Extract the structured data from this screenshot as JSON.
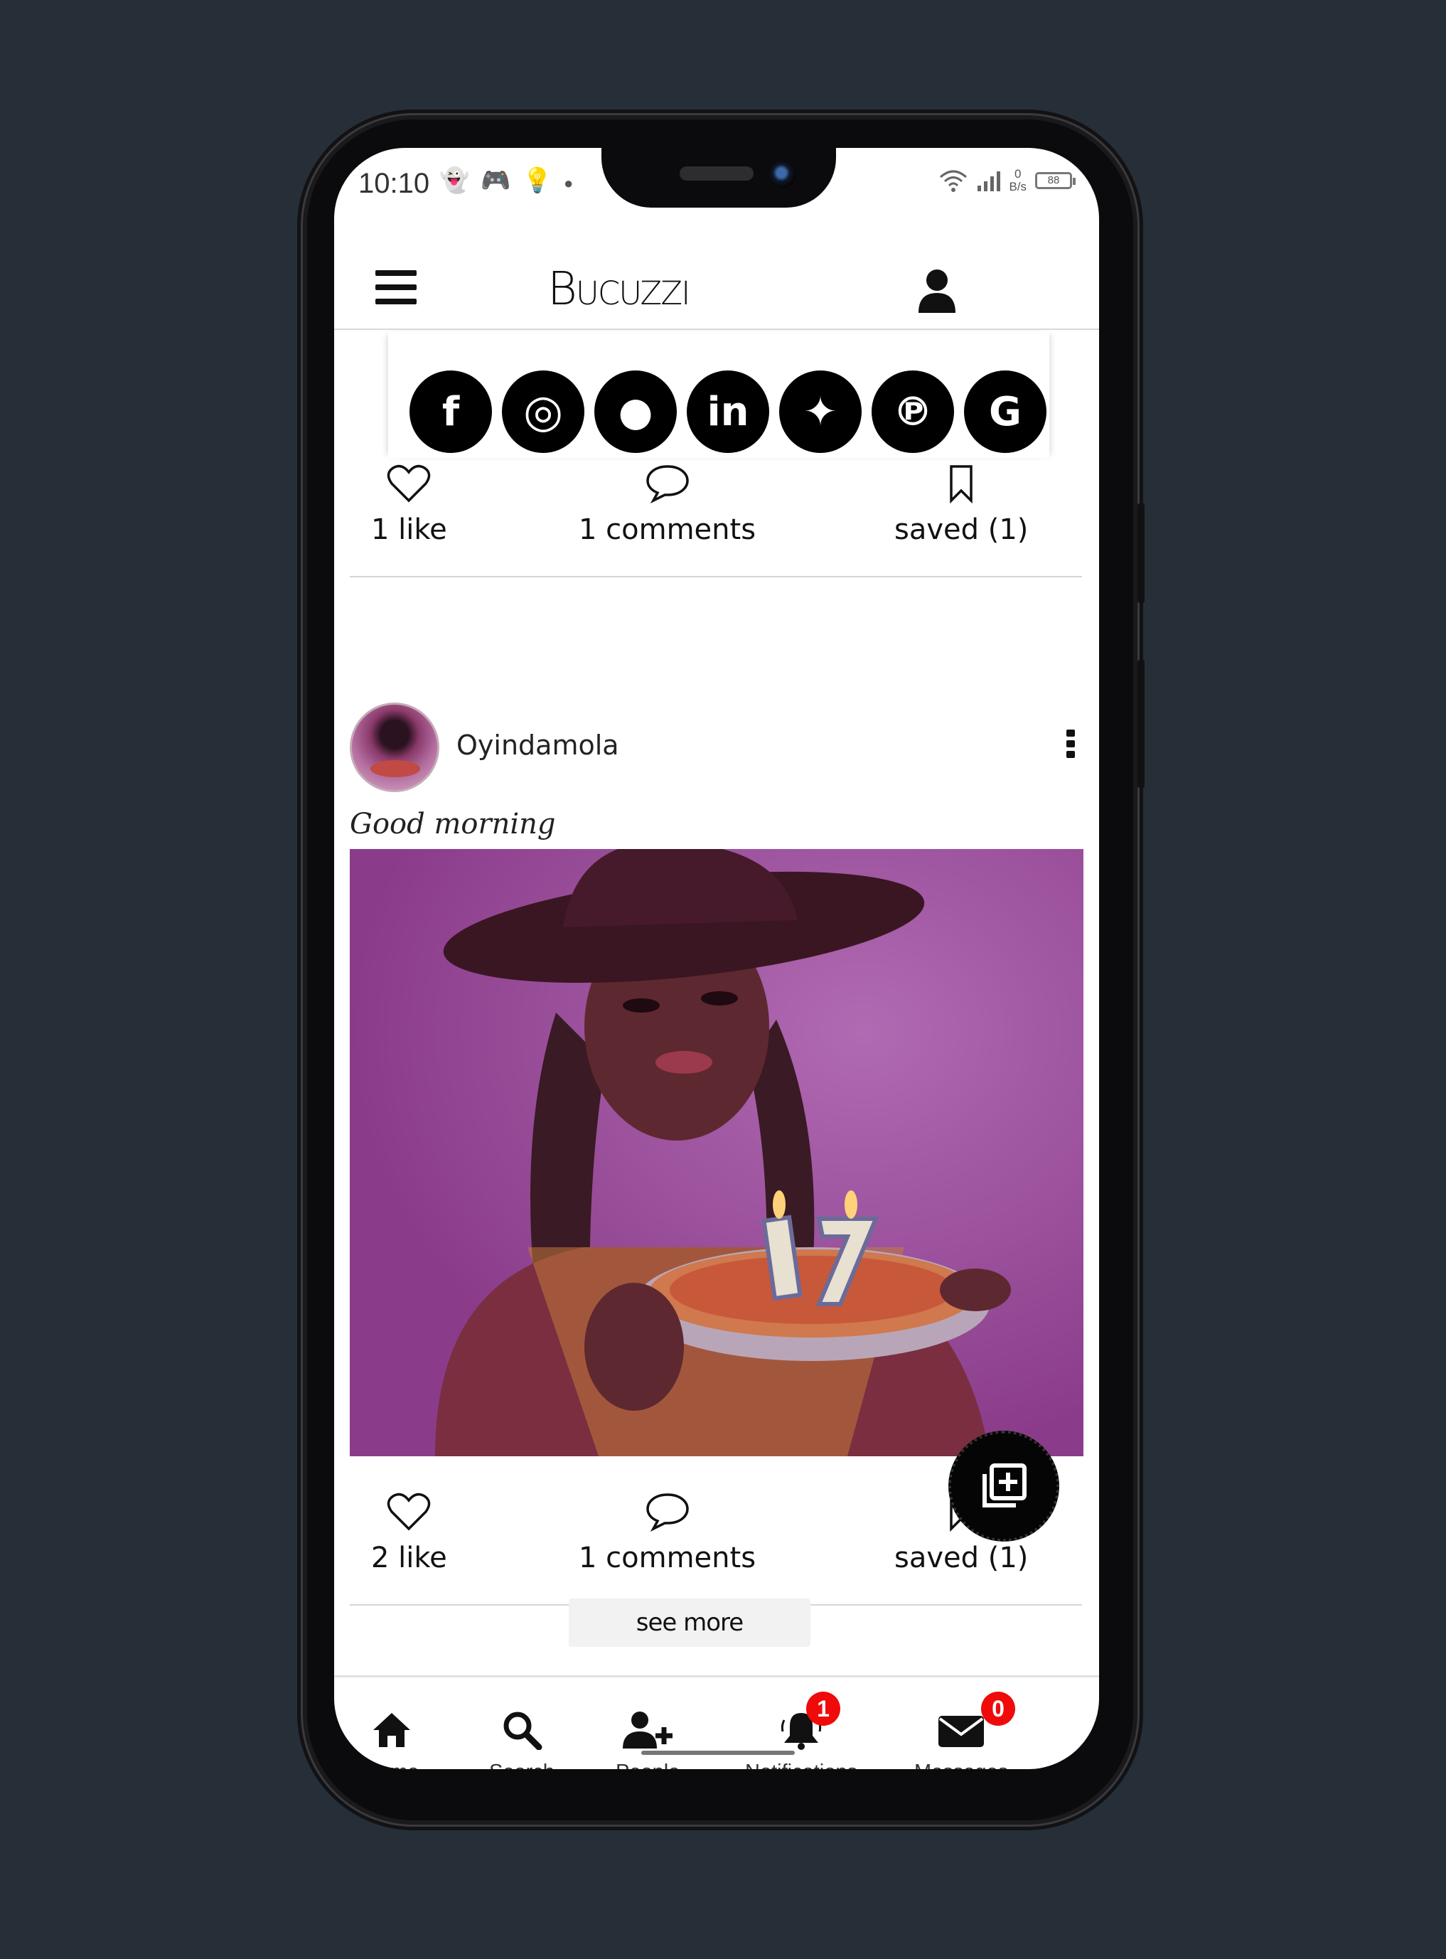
{
  "status_bar": {
    "time": "10:10",
    "left_icons": [
      "ghost-icon",
      "gamepad-icon",
      "bulb-icon",
      "dot-icon"
    ],
    "right_icons": [
      "wifi-icon",
      "signal-icon"
    ],
    "net_rate_value": "0",
    "net_rate_unit": "B/s",
    "battery": "88"
  },
  "app_bar": {
    "brand": "Bucuzzi",
    "menu_icon": "hamburger-icon",
    "profile_icon": "user-icon"
  },
  "social_links": [
    {
      "icon": "facebook-icon",
      "glyph": "f"
    },
    {
      "icon": "instagram-icon",
      "glyph": "◎"
    },
    {
      "icon": "github-icon",
      "glyph": "●"
    },
    {
      "icon": "linkedin-icon",
      "glyph": "in"
    },
    {
      "icon": "twitter-icon",
      "glyph": "✦"
    },
    {
      "icon": "pinterest-icon",
      "glyph": "℗"
    },
    {
      "icon": "google-icon",
      "glyph": "G"
    }
  ],
  "first_post_actions": {
    "likes": "1 like",
    "comments": "1 comments",
    "saved": "saved (1)"
  },
  "post": {
    "author": "Oyindamola",
    "caption": "Good morning",
    "image_alt": "woman in a hat holding a pie with 17 candles",
    "likes": "2 like",
    "comments": "1 comments",
    "saved": "saved (1)"
  },
  "see_more": "see more",
  "fab_icon": "add-post-icon",
  "bottom_nav": [
    {
      "label": "Home",
      "icon": "home-icon"
    },
    {
      "label": "Search",
      "icon": "search-icon"
    },
    {
      "label": "People",
      "icon": "add-person-icon"
    },
    {
      "label": "Notifications",
      "icon": "bell-icon",
      "badge": "1"
    },
    {
      "label": "Messages",
      "icon": "envelope-icon",
      "badge": "0"
    }
  ],
  "colors": {
    "background": "#262f37",
    "badge": "#f00a0a",
    "social_button": "#000000"
  }
}
